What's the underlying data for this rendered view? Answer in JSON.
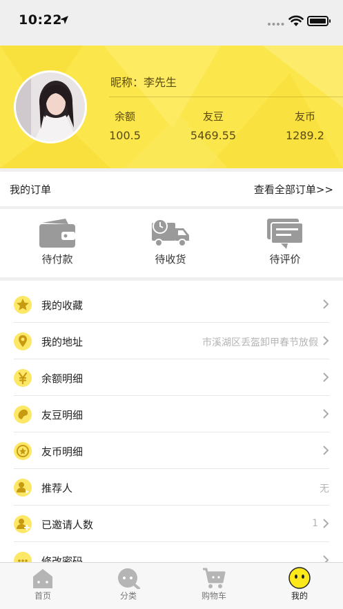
{
  "status_bar": {
    "time": "10:22"
  },
  "profile": {
    "nickname": "昵称：李先生",
    "stats": [
      {
        "label": "余额",
        "value": "100.5"
      },
      {
        "label": "友豆",
        "value": "5469.55"
      },
      {
        "label": "友币",
        "value": "1289.2"
      }
    ]
  },
  "orders": {
    "title": "我的订单",
    "view_all": "查看全部订单>>",
    "items": [
      {
        "label": "待付款",
        "icon": "wallet-icon"
      },
      {
        "label": "待收货",
        "icon": "delivery-truck-icon"
      },
      {
        "label": "待评价",
        "icon": "comment-icon"
      }
    ]
  },
  "menu": {
    "items": [
      {
        "label": "我的收藏",
        "value": "",
        "icon": "star-icon"
      },
      {
        "label": "我的地址",
        "value": "市溪湖区丢盔卸甲春节放假",
        "icon": "location-pin-icon"
      },
      {
        "label": "余额明细",
        "value": "",
        "icon": "yen-icon"
      },
      {
        "label": "友豆明细",
        "value": "",
        "icon": "bean-icon"
      },
      {
        "label": "友币明细",
        "value": "",
        "icon": "coin-icon"
      },
      {
        "label": "推荐人",
        "value": "无",
        "icon": "referrer-icon"
      },
      {
        "label": "已邀请人数",
        "value": "1",
        "icon": "invite-user-icon"
      },
      {
        "label": "修改密码",
        "value": "",
        "icon": "password-icon"
      }
    ]
  },
  "tabbar": {
    "items": [
      {
        "label": "首页",
        "icon": "home-icon"
      },
      {
        "label": "分类",
        "icon": "category-icon"
      },
      {
        "label": "购物车",
        "icon": "cart-icon"
      },
      {
        "label": "我的",
        "icon": "profile-smiley-icon"
      }
    ],
    "active": "我的"
  },
  "colors": {
    "brand_yellow": "#fbe64c",
    "icon_yellow": "#fde766",
    "icon_dark": "#c79a12",
    "gray_icon": "#9a9a9a",
    "muted_text": "#b5b5b5"
  }
}
